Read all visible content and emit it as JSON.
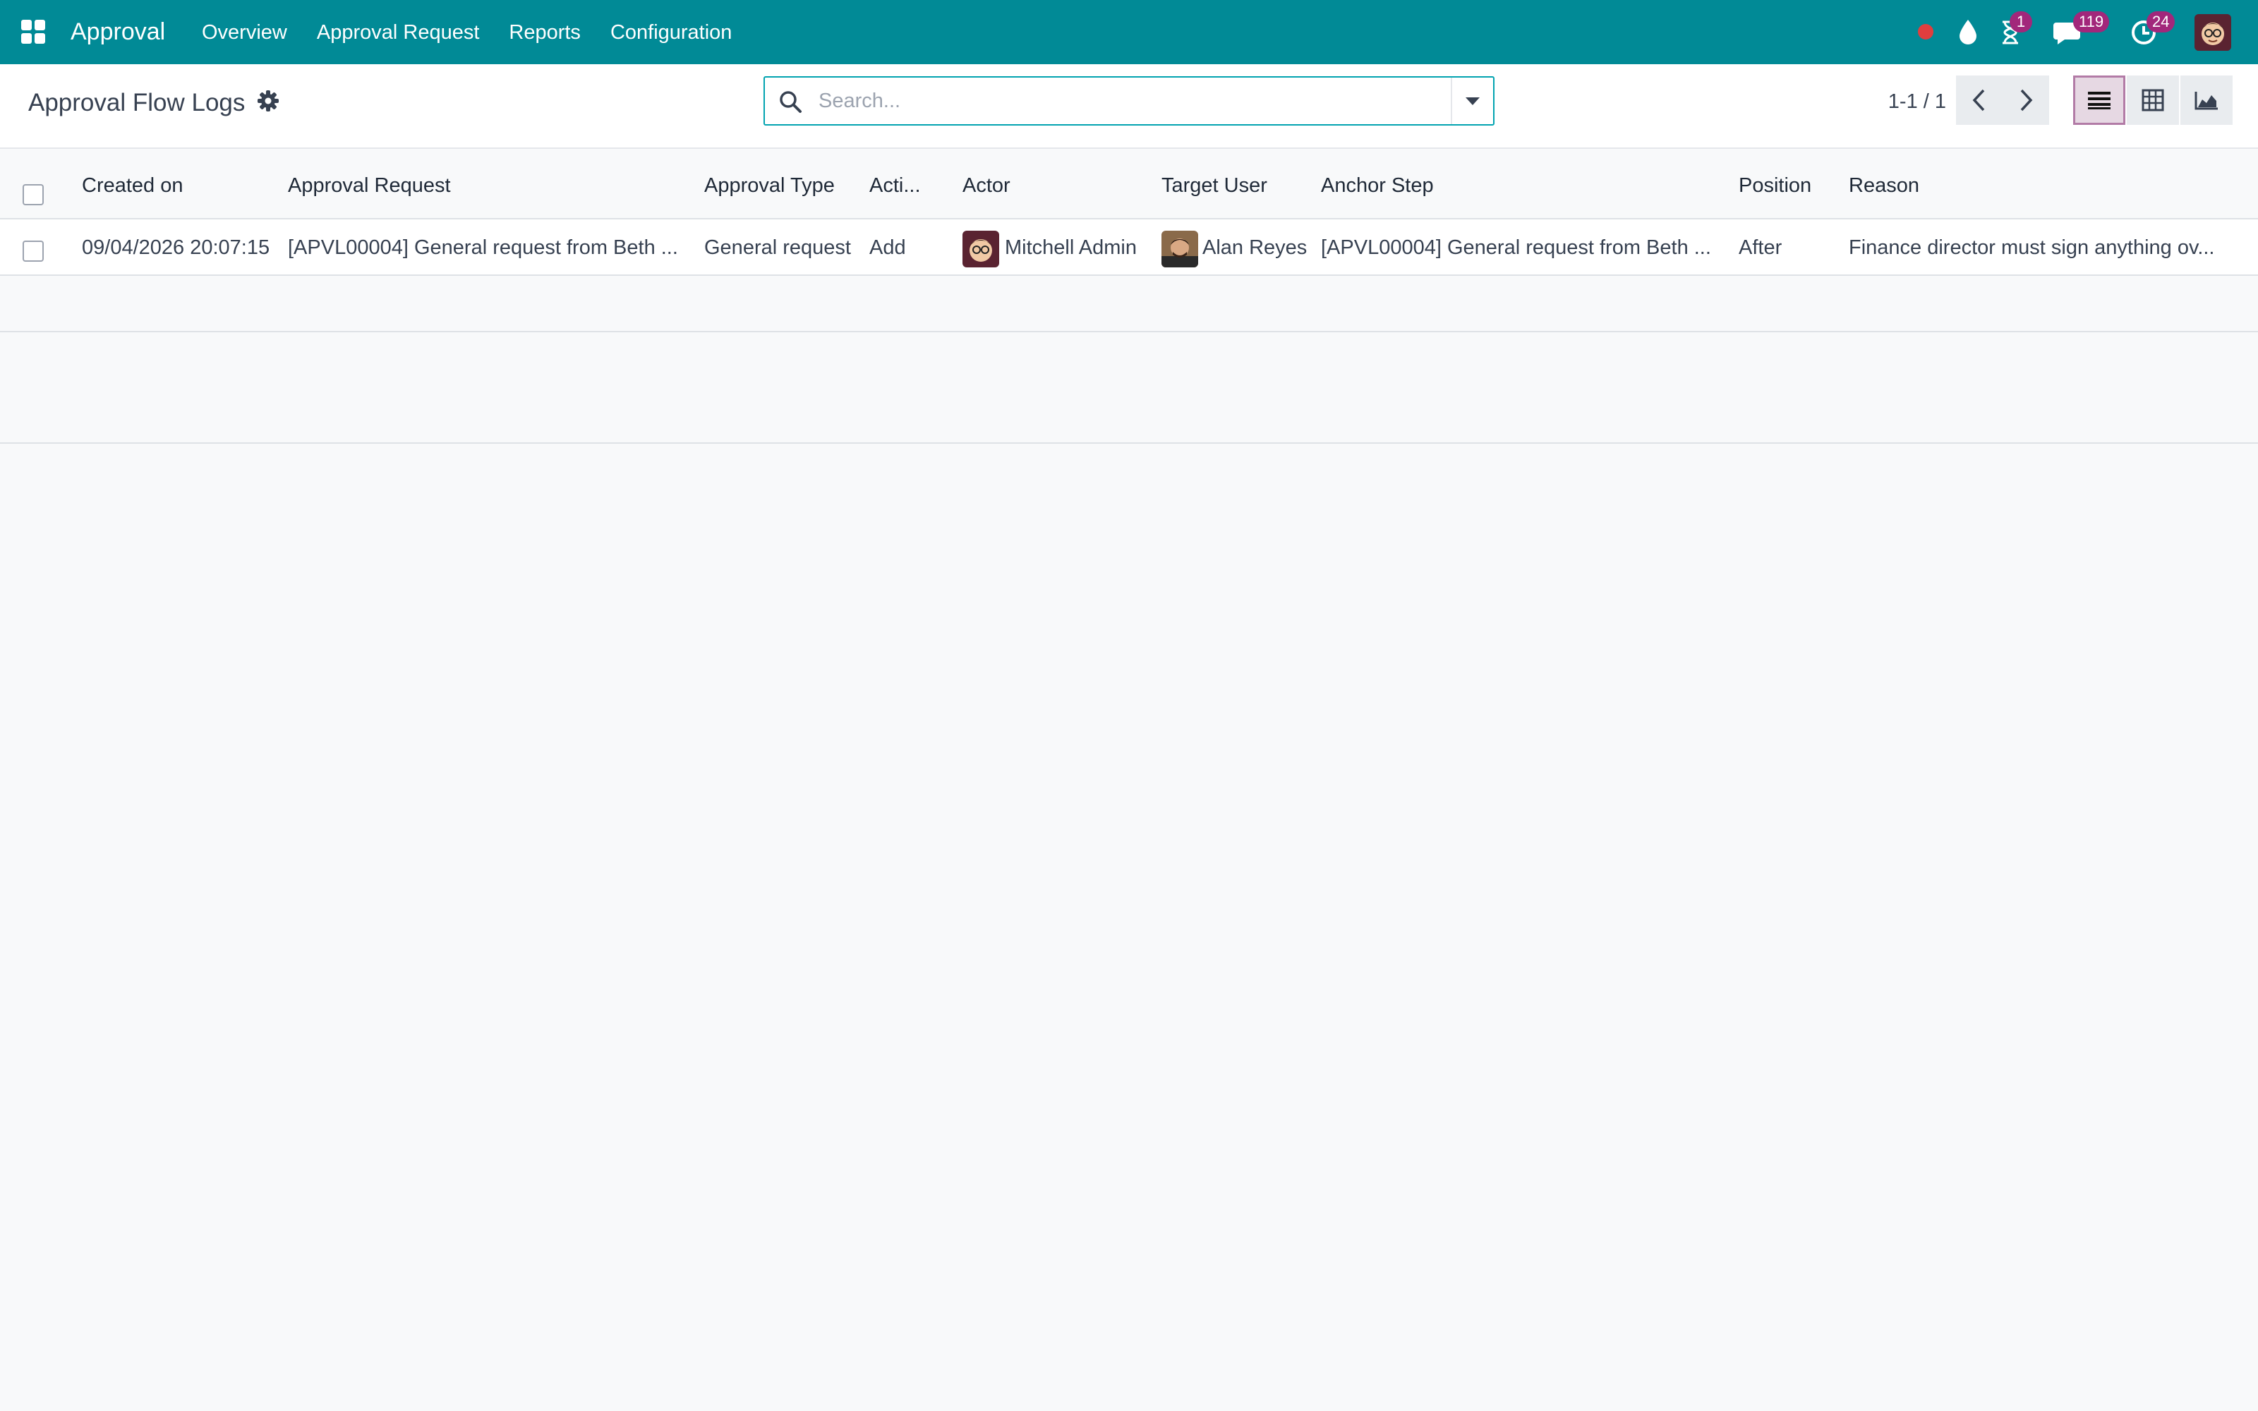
{
  "app": {
    "brand": "Approval",
    "menu": [
      {
        "label": "Overview"
      },
      {
        "label": "Approval Request"
      },
      {
        "label": "Reports"
      },
      {
        "label": "Configuration"
      }
    ],
    "systray": {
      "activity_count": "1",
      "messages_count": "119",
      "updates_count": "24"
    }
  },
  "control_panel": {
    "title": "Approval Flow Logs",
    "search_placeholder": "Search...",
    "pager": "1-1 / 1"
  },
  "table": {
    "columns": [
      "Created on",
      "Approval Request",
      "Approval Type",
      "Acti...",
      "Actor",
      "Target User",
      "Anchor Step",
      "Position",
      "Reason"
    ],
    "rows": [
      {
        "created_on": "09/04/2026 20:07:15",
        "approval_request": "[APVL00004] General request from Beth ...",
        "approval_type": "General request",
        "action": "Add",
        "actor": "Mitchell Admin",
        "target_user": "Alan Reyes",
        "anchor_step": "[APVL00004] General request from Beth ...",
        "position": "After",
        "reason": "Finance director must sign anything ov..."
      }
    ]
  },
  "colors": {
    "topbar": "#018a96",
    "accent": "#01a3b0",
    "badge": "#a2277b",
    "active_view": "#b27ba6"
  }
}
